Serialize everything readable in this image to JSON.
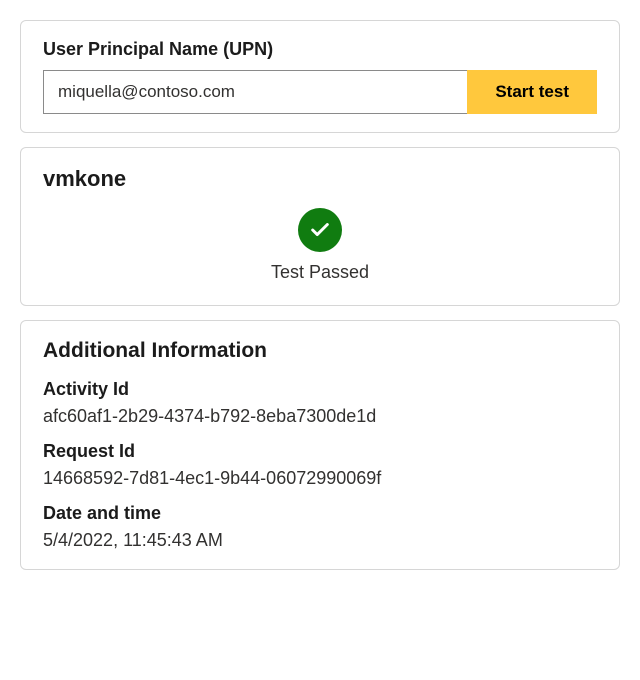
{
  "upn": {
    "label": "User Principal Name (UPN)",
    "value": "miquella@contoso.com",
    "button_label": "Start test"
  },
  "result": {
    "vm_name": "vmkone",
    "status_text": "Test Passed",
    "status_icon": "check-icon",
    "status_color": "#107c10"
  },
  "additional": {
    "title": "Additional Information",
    "items": [
      {
        "label": "Activity Id",
        "value": "afc60af1-2b29-4374-b792-8eba7300de1d"
      },
      {
        "label": "Request Id",
        "value": "14668592-7d81-4ec1-9b44-06072990069f"
      },
      {
        "label": "Date and time",
        "value": "5/4/2022, 11:45:43 AM"
      }
    ]
  }
}
